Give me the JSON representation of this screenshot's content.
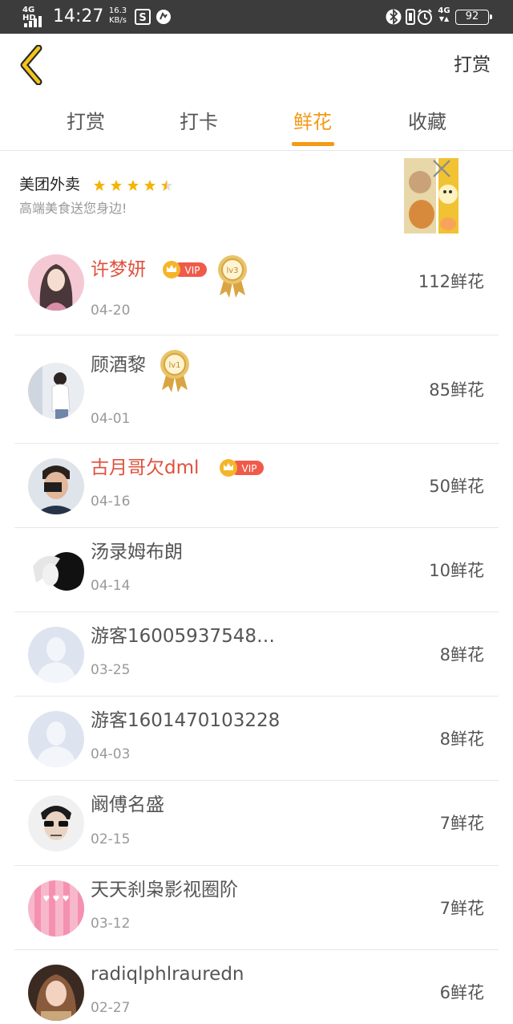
{
  "status_bar": {
    "network_label": "4G HD",
    "time": "14:27",
    "speed_value": "16.3",
    "speed_unit": "KB/s",
    "network_label_right": "4G",
    "battery": "92",
    "icons": [
      "signal-icon",
      "s-app-icon",
      "browser-icon",
      "bluetooth-icon",
      "vibrate-icon",
      "alarm-icon",
      "battery-icon"
    ]
  },
  "header": {
    "back_icon": "chevron-left-icon",
    "action_label": "打赏",
    "accent_color": "#f39a16"
  },
  "tabs": [
    {
      "label": "打赏",
      "active": false
    },
    {
      "label": "打卡",
      "active": false
    },
    {
      "label": "鲜花",
      "active": true
    },
    {
      "label": "收藏",
      "active": false
    }
  ],
  "ad": {
    "title": "美团外卖",
    "rating_stars": 4.5,
    "subtitle": "高端美食送您身边!",
    "close_icon": "close-icon"
  },
  "entries": [
    {
      "name": "许梦妍",
      "date": "04-20",
      "count": "112鲜花",
      "vip": true,
      "vip_label": "VIP",
      "medal": "lv3"
    },
    {
      "name": "顾酒黎",
      "date": "04-01",
      "count": "85鲜花",
      "vip": false,
      "medal": "lv1"
    },
    {
      "name": "古月哥欠dml",
      "date": "04-16",
      "count": "50鲜花",
      "vip": true,
      "vip_label": "VIP"
    },
    {
      "name": "汤录姆布朗",
      "date": "04-14",
      "count": "10鲜花",
      "vip": false
    },
    {
      "name": "游客16005937548…",
      "date": "03-25",
      "count": "8鲜花",
      "vip": false,
      "default_avatar": true
    },
    {
      "name": "游客1601470103228",
      "date": "04-03",
      "count": "8鲜花",
      "vip": false,
      "default_avatar": true
    },
    {
      "name": "阚傅名盛",
      "date": "02-15",
      "count": "7鲜花",
      "vip": false
    },
    {
      "name": "天天刹枭影视圈阶",
      "date": "03-12",
      "count": "7鲜花",
      "vip": false
    },
    {
      "name": "radiqlphlrauredn",
      "date": "02-27",
      "count": "6鲜花",
      "vip": false
    }
  ]
}
